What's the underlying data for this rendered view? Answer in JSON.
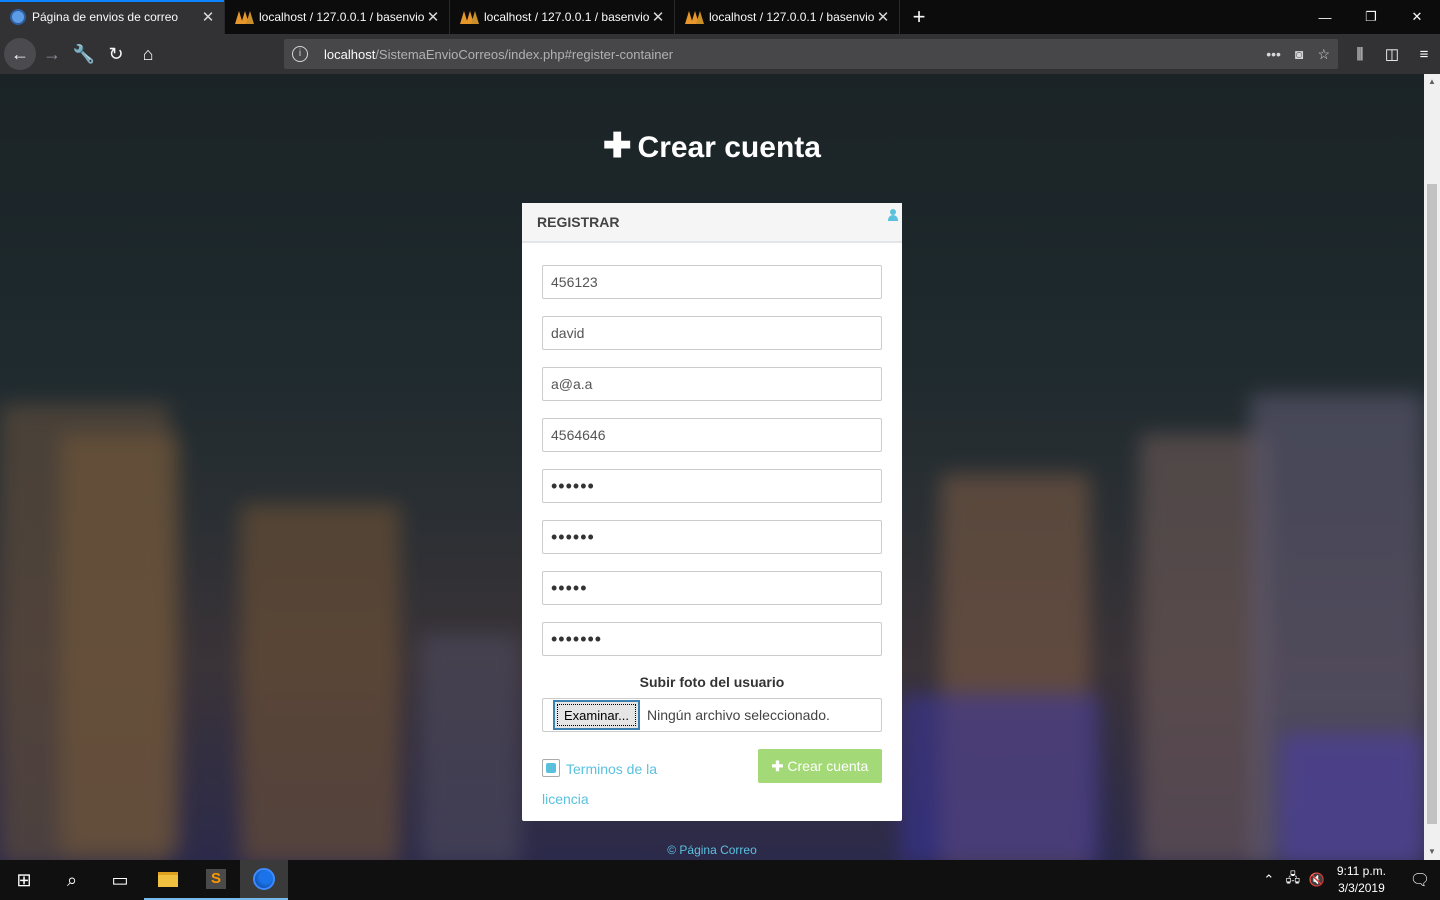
{
  "browser": {
    "tabs": [
      {
        "title": "Página de envios de correo",
        "active": true,
        "icon": "globe-icon"
      },
      {
        "title": "localhost / 127.0.0.1 / basenvio",
        "active": false,
        "icon": "phpmyadmin-icon"
      },
      {
        "title": "localhost / 127.0.0.1 / basenvio",
        "active": false,
        "icon": "phpmyadmin-icon"
      },
      {
        "title": "localhost / 127.0.0.1 / basenvio",
        "active": false,
        "icon": "phpmyadmin-icon"
      }
    ],
    "url_host": "localhost",
    "url_path": "/SistemaEnvioCorreos/index.php#register-container"
  },
  "page": {
    "heading": "Crear cuenta",
    "panel_title": "REGISTRAR",
    "fields": [
      {
        "value": "456123",
        "type": "text"
      },
      {
        "value": "david",
        "type": "text"
      },
      {
        "value": "a@a.a",
        "type": "text"
      },
      {
        "value": "4564646",
        "type": "text"
      },
      {
        "value": "••••••",
        "type": "password"
      },
      {
        "value": "••••••",
        "type": "password"
      },
      {
        "value": "•••••",
        "type": "password"
      },
      {
        "value": "•••••••",
        "type": "password"
      }
    ],
    "upload_label": "Subir foto del usuario",
    "browse_button": "Examinar...",
    "file_status": "Ningún archivo seleccionado.",
    "terms_line1": "Terminos de la",
    "terms_line2": "licencia",
    "terms_checked": true,
    "create_button": "Crear cuenta",
    "footer": "© Página Correo"
  },
  "taskbar": {
    "time": "9:11 p.m.",
    "date": "3/3/2019"
  },
  "colors": {
    "accent": "#5bc0de",
    "create_button": "#a3d977",
    "tab_active_bar": "#0a84ff"
  }
}
